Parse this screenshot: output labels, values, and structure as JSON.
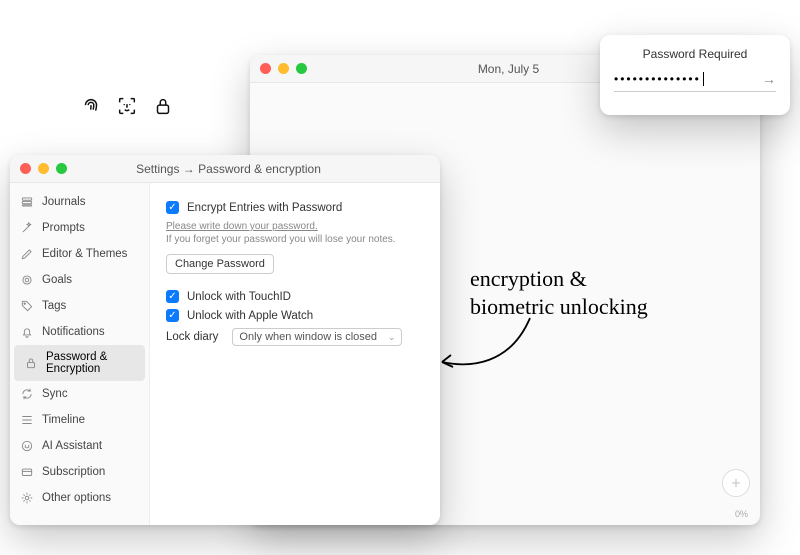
{
  "editor": {
    "date": "Mon, July 5",
    "zoom": "0%"
  },
  "password_popover": {
    "title": "Password Required",
    "value": "••••••••••••••"
  },
  "settings": {
    "title": "Settings → Password & encryption",
    "sidebar": {
      "items": [
        {
          "label": "Journals",
          "icon": "stack"
        },
        {
          "label": "Prompts",
          "icon": "wand"
        },
        {
          "label": "Editor & Themes",
          "icon": "pencil"
        },
        {
          "label": "Goals",
          "icon": "target"
        },
        {
          "label": "Tags",
          "icon": "tag"
        },
        {
          "label": "Notifications",
          "icon": "bell"
        },
        {
          "label": "Password & Encryption",
          "icon": "lock",
          "active": true
        },
        {
          "label": "Sync",
          "icon": "sync"
        },
        {
          "label": "Timeline",
          "icon": "timeline"
        },
        {
          "label": "AI Assistant",
          "icon": "ai"
        },
        {
          "label": "Subscription",
          "icon": "card"
        },
        {
          "label": "Other options",
          "icon": "gear"
        }
      ]
    },
    "pane": {
      "encrypt_label": "Encrypt Entries with Password",
      "warning_underline": "Please write down your password.",
      "warning_plain": "If you forget your password you will lose your notes.",
      "change_pw": "Change Password",
      "touchid": "Unlock with TouchID",
      "watch": "Unlock with Apple Watch",
      "lock_label": "Lock diary",
      "lock_value": "Only when window is closed"
    }
  },
  "annotation": {
    "line1": "encryption &",
    "line2": "biometric unlocking"
  }
}
